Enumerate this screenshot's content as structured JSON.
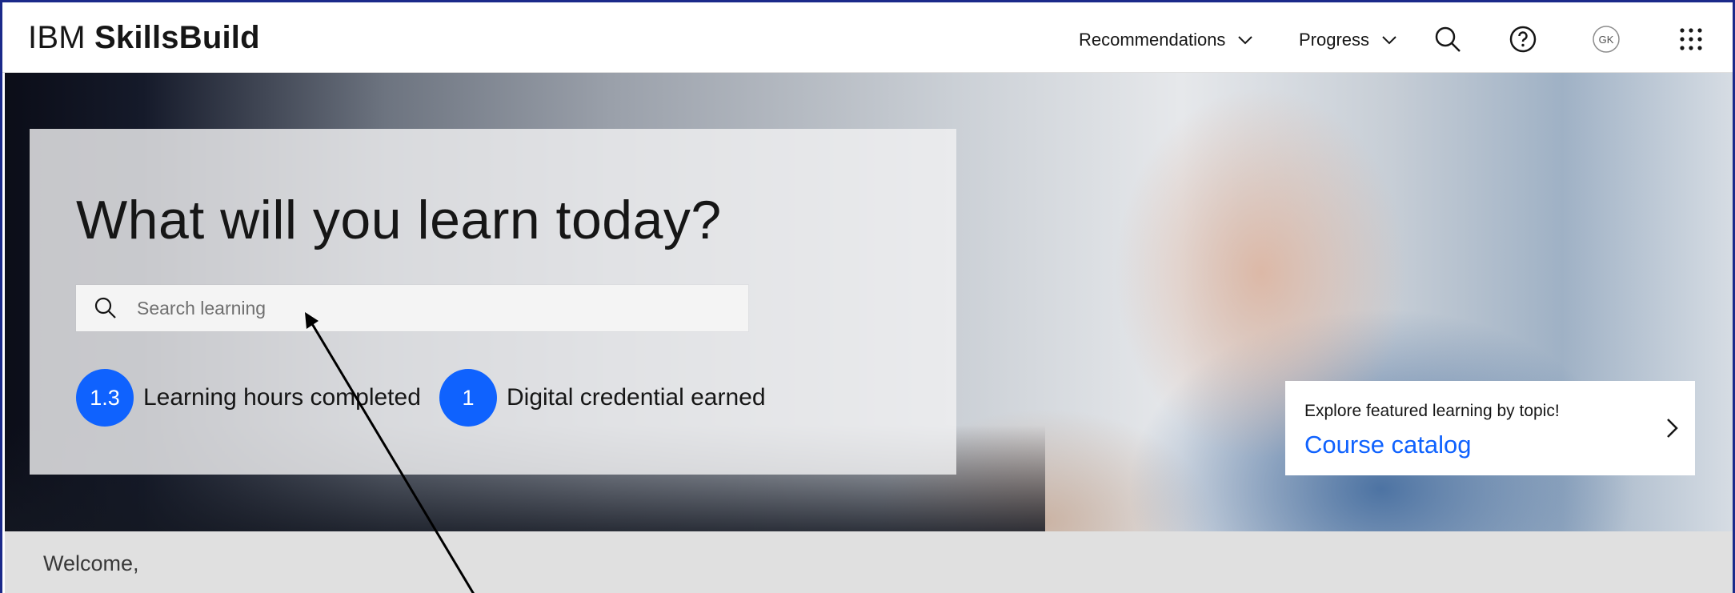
{
  "header": {
    "logo_part1": "IBM",
    "logo_part2": "SkillsBuild",
    "nav": [
      {
        "label": "Recommendations"
      },
      {
        "label": "Progress"
      }
    ],
    "avatar_initials": "GK",
    "icons": [
      "search-icon",
      "help-icon",
      "avatar",
      "app-switcher-icon"
    ]
  },
  "hero": {
    "title": "What will you learn today?",
    "search_placeholder": "Search learning",
    "stats": [
      {
        "value": "1.3",
        "label": "Learning hours completed"
      },
      {
        "value": "1",
        "label": "Digital credential earned"
      }
    ],
    "catalog": {
      "subtitle": "Explore featured learning by topic!",
      "title": "Course catalog"
    }
  },
  "welcome": {
    "text": "Welcome,"
  },
  "colors": {
    "accent": "#0f62fe",
    "frame": "#1b2a8a",
    "welcome_bg": "#e0e0e0"
  }
}
